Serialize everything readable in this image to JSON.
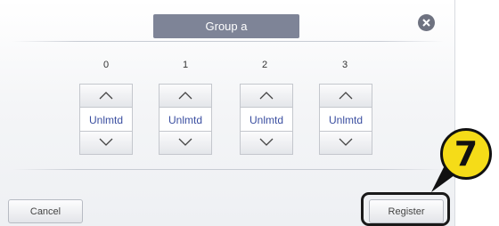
{
  "dialog": {
    "title": "Group a",
    "close_icon": "close-circle-icon"
  },
  "columns": [
    {
      "number": "0",
      "value": "Unlmtd",
      "up_icon": "chevron-up-icon",
      "down_icon": "chevron-down-icon"
    },
    {
      "number": "1",
      "value": "Unlmtd",
      "up_icon": "chevron-up-icon",
      "down_icon": "chevron-down-icon"
    },
    {
      "number": "2",
      "value": "Unlmtd",
      "up_icon": "chevron-up-icon",
      "down_icon": "chevron-down-icon"
    },
    {
      "number": "3",
      "value": "Unlmtd",
      "up_icon": "chevron-up-icon",
      "down_icon": "chevron-down-icon"
    }
  ],
  "footer": {
    "cancel_label": "Cancel",
    "register_label": "Register"
  },
  "annotation": {
    "step_number": "7",
    "badge_color": "#f5dc18"
  },
  "colors": {
    "title_bg": "#7e8497",
    "value_text": "#3a4ea0"
  }
}
